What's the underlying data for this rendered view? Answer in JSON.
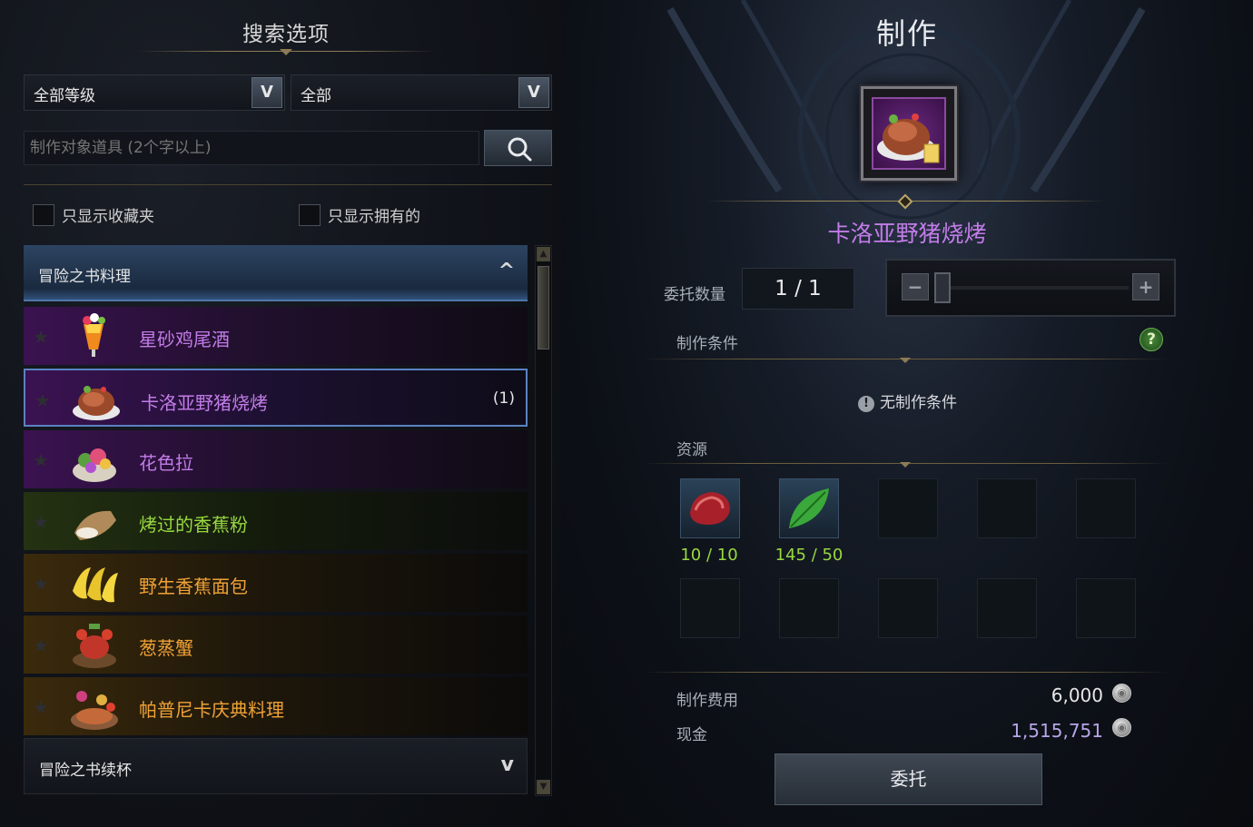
{
  "search_panel": {
    "title": "搜索选项",
    "grade_select": "全部等级",
    "type_select": "全部",
    "search_placeholder": "制作对象道具 (2个字以上)",
    "checkbox_favorites": "只显示收藏夹",
    "checkbox_owned": "只显示拥有的"
  },
  "recipe_list": {
    "category_open": "冒险之书料理",
    "category_closed": "冒险之书续杯",
    "items": [
      {
        "name": "星砂鸡尾酒",
        "grade": "purple",
        "icon": "cocktail-icon",
        "count": ""
      },
      {
        "name": "卡洛亚野猪烧烤",
        "grade": "purple",
        "icon": "roast-boar-icon",
        "count": "(1)",
        "selected": true
      },
      {
        "name": "花色拉",
        "grade": "purple",
        "icon": "flower-salad-icon",
        "count": ""
      },
      {
        "name": "烤过的香蕉粉",
        "grade": "green",
        "icon": "banana-flour-icon",
        "count": ""
      },
      {
        "name": "野生香蕉面包",
        "grade": "orange",
        "icon": "banana-bread-icon",
        "count": ""
      },
      {
        "name": "葱蒸蟹",
        "grade": "orange",
        "icon": "steamed-crab-icon",
        "count": ""
      },
      {
        "name": "帕普尼卡庆典料理",
        "grade": "orange",
        "icon": "festival-dish-icon",
        "count": ""
      }
    ]
  },
  "craft_panel": {
    "title": "制作",
    "item_name": "卡洛亚野猪烧烤",
    "quantity_label": "委托数量",
    "quantity_value": "1 / 1",
    "conditions_label": "制作条件",
    "help_symbol": "?",
    "no_conditions": "无制作条件",
    "resources_label": "资源",
    "resources": [
      {
        "icon": "meat-icon",
        "count": "10 / 10"
      },
      {
        "icon": "leaf-icon",
        "count": "145 / 50"
      }
    ],
    "cost_label": "制作费用",
    "cost_value": "6,000",
    "cash_label": "现金",
    "cash_value": "1,515,751",
    "commit_button": "委托"
  },
  "colors": {
    "purple_grade": "#c27ce8",
    "green_grade": "#98d840",
    "orange_grade": "#f0a236",
    "cash": "#b7a6e6"
  }
}
